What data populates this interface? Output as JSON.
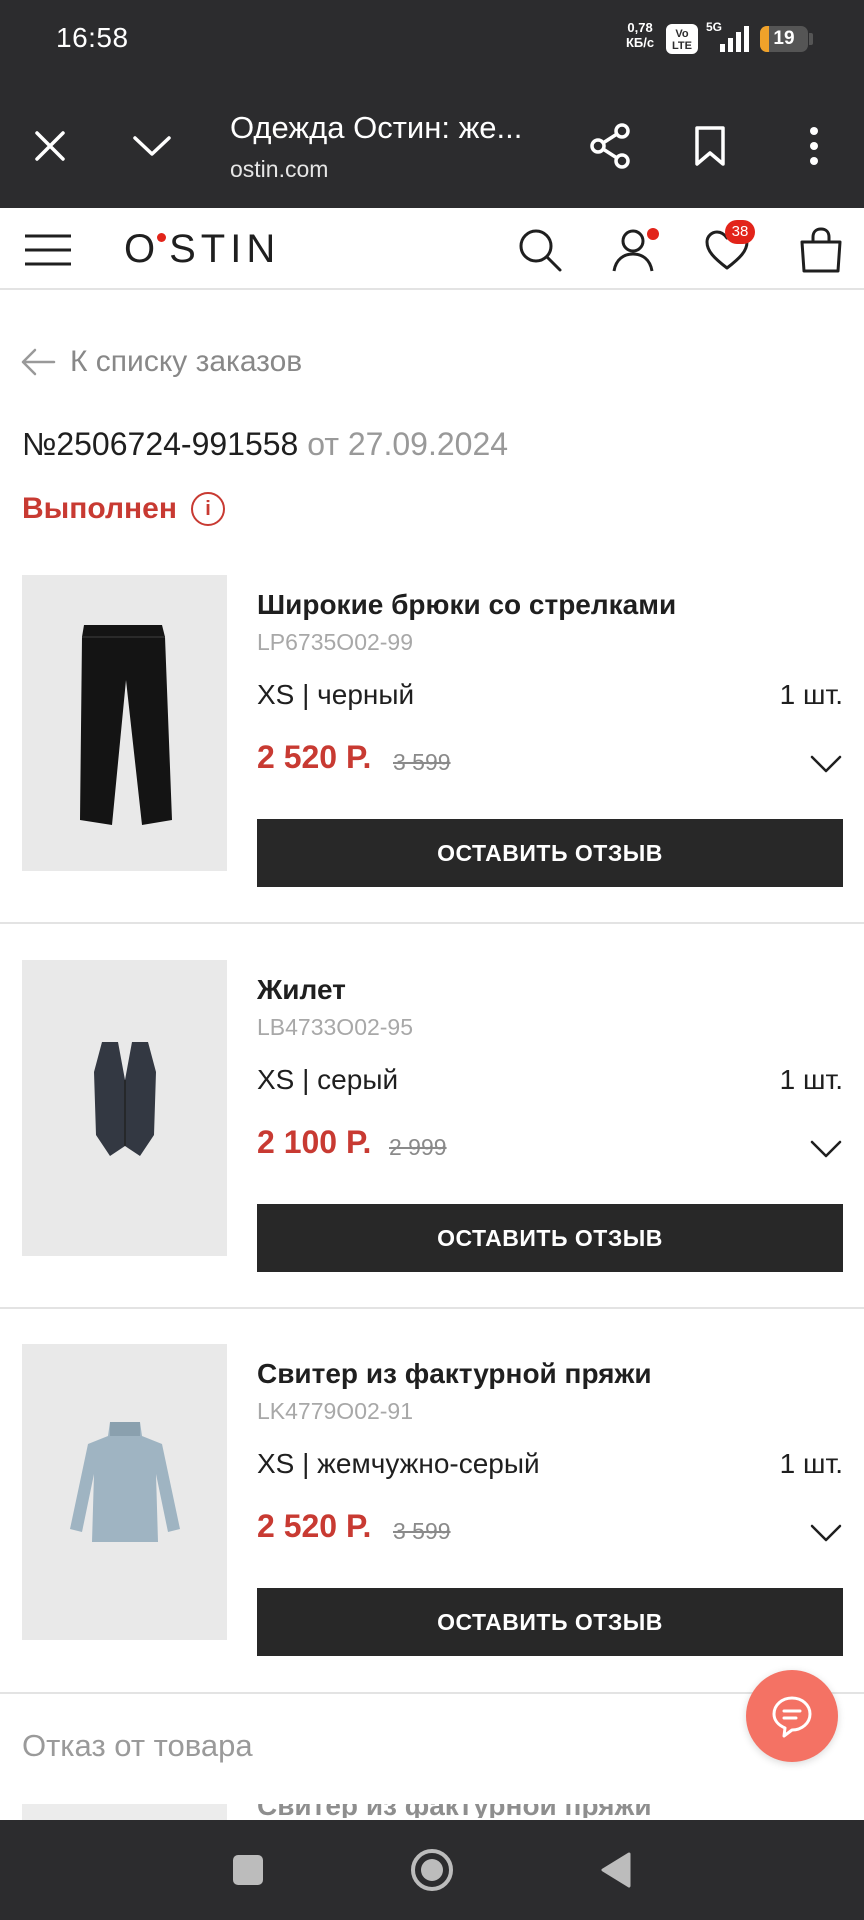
{
  "status_bar": {
    "time": "16:58",
    "net_speed_value": "0,78",
    "net_speed_unit": "КБ/с",
    "volte": "Vo LTE",
    "network": "5G",
    "battery": "19",
    "battery_level": 0.19
  },
  "browser": {
    "page_title": "Одежда Остин: же...",
    "url": "ostin.com",
    "icons": [
      "close-icon",
      "chevron-down-icon",
      "share-icon",
      "bookmark-icon",
      "more-vert-icon"
    ]
  },
  "site_header": {
    "logo": "STIN",
    "logo_prefix": "O",
    "favorites_count": "38",
    "icons": [
      "menu-icon",
      "search-icon",
      "user-icon",
      "heart-icon",
      "bag-icon"
    ],
    "accent_color": "#e2241a"
  },
  "order": {
    "back_label": "К списку заказов",
    "number": "№2506724-991558",
    "date": "от 27.09.2024",
    "status": "Выполнен",
    "status_info": "i",
    "status_color": "#c83a32"
  },
  "items": [
    {
      "name": "Широкие брюки со стрелками",
      "sku": "LP6735O02-99",
      "variant": "XS | черный",
      "qty": "1 шт.",
      "price": "2 520 Р.",
      "old_price": "3 599",
      "review_label": "ОСТАВИТЬ ОТЗЫВ"
    },
    {
      "name": "Жилет",
      "sku": "LB4733O02-95",
      "variant": "XS | серый",
      "qty": "1 шт.",
      "price": "2 100 Р.",
      "old_price": "2 999",
      "review_label": "ОСТАВИТЬ ОТЗЫВ"
    },
    {
      "name": "Свитер из фактурной пряжи",
      "sku": "LK4779O02-91",
      "variant": "XS | жемчужно-серый",
      "qty": "1 шт.",
      "price": "2 520 Р.",
      "old_price": "3 599",
      "review_label": "ОСТАВИТЬ ОТЗЫВ"
    }
  ],
  "refusal_section": {
    "title": "Отказ от товара",
    "partial_item_name": "Свитер из фактурной пряжи"
  }
}
